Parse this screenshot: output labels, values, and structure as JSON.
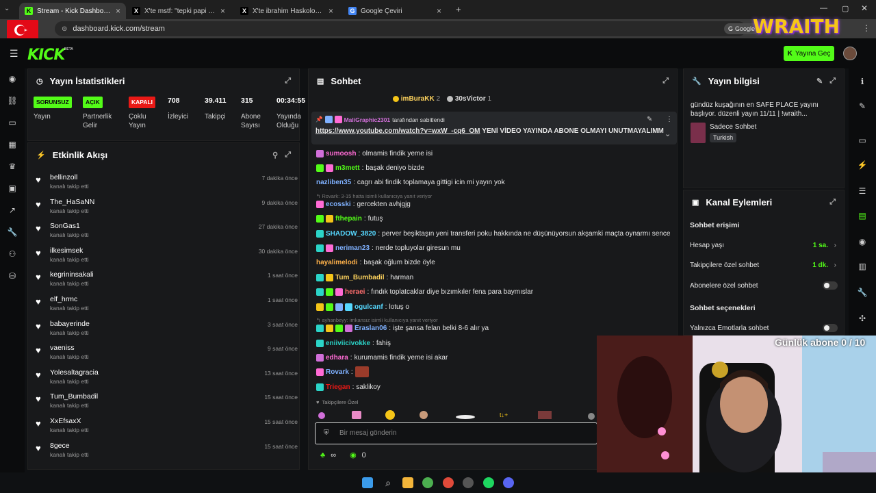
{
  "browser": {
    "tabs": [
      {
        "label": "Stream - Kick Dashboard",
        "active": true,
        "icon": "kick-icon"
      },
      {
        "label": "X'te mstf: \"tepki papi manifestit\"",
        "active": false,
        "icon": "x-icon"
      },
      {
        "label": "X'te ibrahim Haskoloğlu: \"İstanb",
        "active": false,
        "icon": "x-icon"
      },
      {
        "label": "Google Çeviri",
        "active": false,
        "icon": "google-translate-icon"
      }
    ],
    "url": "dashboard.kick.com/stream",
    "google_label": "Google"
  },
  "overlay": {
    "brand": "WRAITH",
    "sub_goal": "Günlük abone 0 / 10"
  },
  "topnav": {
    "logo": "KICK",
    "logo_beta": "BETA",
    "go_live": "Yayına Geç"
  },
  "stats": {
    "title": "Yayın İstatistikleri",
    "items": [
      {
        "badge": "SORUNSUZ",
        "label": "Yayın"
      },
      {
        "badge": "AÇIK",
        "label": "Partnerlik Gelir Programı"
      },
      {
        "badge": "KAPALI",
        "label": "Çoklu Yayın"
      },
      {
        "value": "708",
        "label": "İzleyici"
      },
      {
        "value": "39.411",
        "label": "Takipçi"
      },
      {
        "value": "315",
        "label": "Abone Sayısı"
      },
      {
        "value": "00:34:55",
        "label": "Yayında Olduğu Süre"
      }
    ]
  },
  "feed": {
    "title": "Etkinlik Akışı",
    "action": "kanalı takip etti",
    "items": [
      {
        "name": "bellinzoll",
        "time": "7 dakika önce"
      },
      {
        "name": "The_HaSaNN",
        "time": "9 dakika önce"
      },
      {
        "name": "SonGas1",
        "time": "27 dakika önce"
      },
      {
        "name": "ilkesimsek",
        "time": "30 dakika önce"
      },
      {
        "name": "kegrininsakali",
        "time": "1 saat önce"
      },
      {
        "name": "elf_hrmc",
        "time": "1 saat önce"
      },
      {
        "name": "babayerinde",
        "time": "3 saat önce"
      },
      {
        "name": "vaeniss",
        "time": "9 saat önce"
      },
      {
        "name": "Yolesaltagracia",
        "time": "13 saat önce"
      },
      {
        "name": "Tum_Bumbadil",
        "time": "15 saat önce"
      },
      {
        "name": "XxEfsaxX",
        "time": "15 saat önce"
      },
      {
        "name": "8gece",
        "time": "15 saat önce"
      }
    ]
  },
  "chat": {
    "title": "Sohbet",
    "top_gifters": [
      {
        "name": "imBuraKK",
        "count": "2"
      },
      {
        "name": "30sVictor",
        "count": "1"
      }
    ],
    "pinned": {
      "by_user": "MaliGraphic2301",
      "by_suffix": "tarafından sabitlendi",
      "link": "https://www.youtube.com/watch?v=wxW_-cq6_OM",
      "text": "YENİ VİDEO YAYINDA ABONE OLMAYI UNUTMAYALIMM"
    },
    "messages": [
      {
        "user": "sumoosh",
        "color": "#ff6bd5",
        "text": "olmamis findik yeme isi",
        "badges": [
          "#d16fd9"
        ]
      },
      {
        "user": "m3mett",
        "color": "#53fc18",
        "text": "başak deniyo bizde",
        "badges": [
          "#53fc18",
          "#ff6bd5"
        ]
      },
      {
        "user": "nazliben35",
        "color": "#7fb1ff",
        "text": "cagrı abi findik toplamaya gittigi icin mi yayın yok",
        "badges": []
      },
      {
        "reply": "Rovark: 3-15 hatta isimli kullanıcıya yanıt veriyor"
      },
      {
        "user": "ecosski",
        "color": "#7fb1ff",
        "text": "gercekten avhjgjg",
        "badges": [
          "#ff6bd5"
        ]
      },
      {
        "user": "fthepain",
        "color": "#53fc18",
        "text": "futuş",
        "badges": [
          "#53fc18",
          "#f5c518"
        ]
      },
      {
        "user": "SHADOW_3820",
        "color": "#56d8ff",
        "text": "perver beşiktaşın yeni transferi poku hakkında ne düşünüyorsun akşamki maçta oynarmı sence",
        "badges": [
          "#2bd4c8"
        ]
      },
      {
        "user": "neriman23",
        "color": "#7fb1ff",
        "text": "nerde topluyolar giresun mu",
        "badges": [
          "#2bd4c8",
          "#ff6bd5"
        ]
      },
      {
        "user": "hayalimelodi",
        "color": "#ffb14a",
        "text": "başak oğlum bizde öyle",
        "badges": []
      },
      {
        "user": "Tum_Bumbadil",
        "color": "#ffd45e",
        "text": "harman",
        "badges": [
          "#2bd4c8",
          "#f5c518"
        ]
      },
      {
        "user": "heraei",
        "color": "#ff6e6e",
        "text": "fındık toplatcaklar diye bızımkıler fena para baymıslar",
        "badges": [
          "#2bd4c8",
          "#53fc18",
          "#ff6bd5"
        ]
      },
      {
        "user": "ogulcanf",
        "color": "#56d8ff",
        "text": "lotuş o",
        "badges": [
          "#f5c518",
          "#53fc18",
          "#7fb1ff",
          "#56d8ff"
        ]
      },
      {
        "reply": "ayhanbeyy: imkansız isimli kullanıcıya yanıt veriyor"
      },
      {
        "user": "Eraslan06",
        "color": "#7fb1ff",
        "text": "işte şansa felan belki 8-6 alır ya",
        "badges": [
          "#2bd4c8",
          "#f5c518",
          "#53fc18",
          "#d16fd9"
        ]
      },
      {
        "user": "eniiviicivokke",
        "color": "#2bd4c8",
        "text": "fahiş",
        "badges": [
          "#2bd4c8"
        ]
      },
      {
        "user": "edhara",
        "color": "#ff6bd5",
        "text": "kurumamis findik yeme isi akar",
        "badges": [
          "#d16fd9"
        ]
      },
      {
        "user": "Rovark",
        "color": "#7fb1ff",
        "text": "",
        "badges": [
          "#ff6bd5"
        ],
        "emote": true
      },
      {
        "user": "Triegan",
        "color": "#e91916",
        "text": "saklikoy",
        "badges": [
          "#2bd4c8"
        ]
      }
    ],
    "followers_only": "Takipçilere Özel",
    "input_placeholder": "Bir mesaj gönderin",
    "footer_count": "0"
  },
  "stream_info": {
    "title": "Yayın bilgisi",
    "description": "gündüz kuşağının en SAFE PLACE yayını başlıyor. düzenli yayın 11/11 | !wraith...",
    "category": "Sadece Sohbet",
    "tag": "Turkish"
  },
  "channel_actions": {
    "title": "Kanal Eylemleri",
    "access_title": "Sohbet erişimi",
    "rows": [
      {
        "label": "Hesap yaşı",
        "value": "1 sa."
      },
      {
        "label": "Takipçilere özel sohbet",
        "value": "1 dk."
      },
      {
        "label": "Abonelere özel sohbet",
        "toggle": true
      }
    ],
    "options_title": "Sohbet seçenekleri",
    "option_rows": [
      {
        "label": "Yalnızca Emotlarla sohbet",
        "toggle": true
      }
    ]
  }
}
